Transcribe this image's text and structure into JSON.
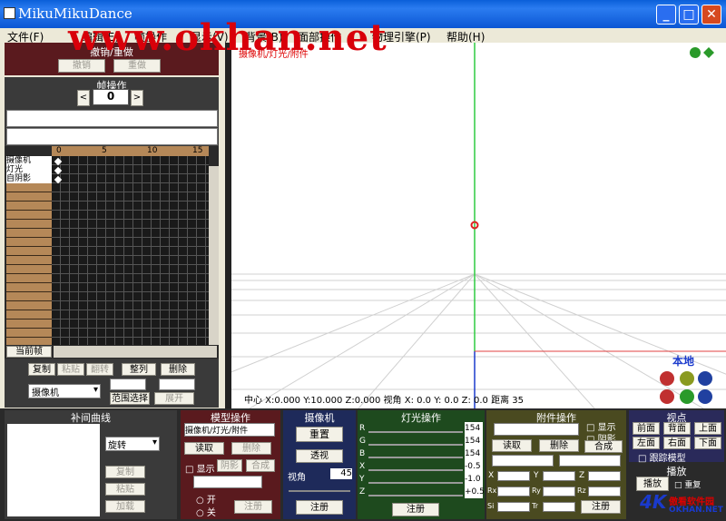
{
  "window": {
    "title": "MikuMikuDance",
    "minimize": "_",
    "maximize": "□",
    "close": "✕"
  },
  "menu": [
    "文件(F)",
    "编辑(E)",
    "帧操作",
    "显示(V)",
    "背景(B)",
    "面部操作",
    "物理引擎(P)",
    "帮助(H)"
  ],
  "watermark": "www.okhan.net",
  "undo_panel": {
    "title": "撤销/重做",
    "undo": "撤销",
    "redo": "重做"
  },
  "frame_panel": {
    "title": "帧操作",
    "prev": "<",
    "next": ">",
    "frame": "0"
  },
  "timeline": {
    "ticks": [
      "0",
      "5",
      "10",
      "15"
    ],
    "tracks": [
      "摄像机",
      "灯光",
      "自阴影"
    ],
    "current": "当前帧"
  },
  "edit_buttons": {
    "copy": "复制",
    "paste": "粘贴",
    "reverse": "翻转",
    "align": "整列",
    "delete": "删除",
    "select": "摄像机",
    "range": "范围选择",
    "expand": "展开"
  },
  "interp": {
    "title": "补间曲线",
    "select": "旋转",
    "copy": "复制",
    "paste": "粘贴",
    "linear": "加载"
  },
  "model_panel": {
    "title": "模型操作",
    "select": "摄像机/灯光/附件",
    "load": "读取",
    "delete": "删除",
    "show": "显示",
    "shadow": "阴影",
    "compose": "合成",
    "on": "开",
    "off": "关",
    "register": "注册"
  },
  "camera_panel": {
    "title": "摄像机",
    "reset": "重置",
    "perspective": "透视",
    "fov_label": "视角",
    "fov": "45",
    "register": "注册"
  },
  "light_panel": {
    "title": "灯光操作",
    "r": "R",
    "g": "G",
    "b": "B",
    "x": "X",
    "y": "Y",
    "z": "Z",
    "rv": "154",
    "gv": "154",
    "bv": "154",
    "xv": "-0.5",
    "yv": "-1.0",
    "zv": "+0.5",
    "register": "注册"
  },
  "accessory_panel": {
    "title": "附件操作",
    "show": "显示",
    "shadow": "阴影",
    "load": "读取",
    "delete": "删除",
    "compose": "合成",
    "x": "X",
    "y": "Y",
    "z": "Z",
    "rx": "Rx",
    "ry": "Ry",
    "rz": "Rz",
    "si": "Si",
    "tr": "Tr",
    "register": "注册"
  },
  "view_panel": {
    "title": "视点",
    "front": "前面",
    "back": "背面",
    "top": "上面",
    "left": "左面",
    "right": "右面",
    "bottom": "下面",
    "follow": "跟踪模型"
  },
  "play_panel": {
    "title": "播放",
    "play": "播放",
    "repeat": "重复"
  },
  "viewport": {
    "mode_label": "摄像机/灯光/附件",
    "local": "本地",
    "status": "中心   X:0.000 Y:10.000 Z:0.000  视角  X: 0.0 Y: 0.0 Z: 0.0  距离      35"
  },
  "logo": {
    "main": "4K",
    "text1": "傲看软件园",
    "text2": "OKHAN.NET"
  }
}
